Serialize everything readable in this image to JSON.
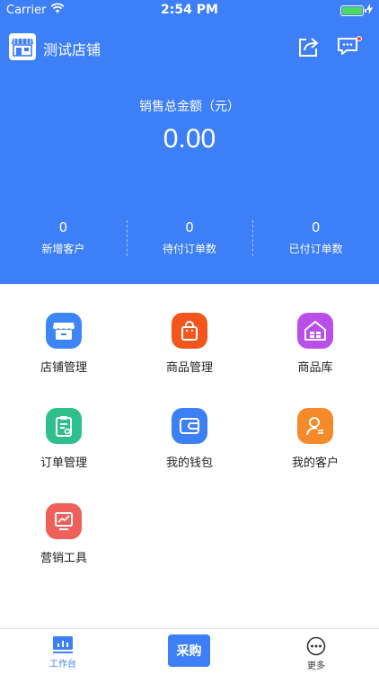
{
  "status_bar": {
    "carrier": "Carrier",
    "time": "2:54 PM"
  },
  "header": {
    "shop_name": "测试店铺"
  },
  "sales": {
    "label": "销售总金额（元）",
    "value": "0.00"
  },
  "stats": [
    {
      "value": "0",
      "label": "新增客户"
    },
    {
      "value": "0",
      "label": "待付订单数"
    },
    {
      "value": "0",
      "label": "已付订单数"
    }
  ],
  "menu": [
    {
      "label": "店铺管理",
      "icon": "store-icon",
      "color": "#3d86f7"
    },
    {
      "label": "商品管理",
      "icon": "shopping-bag-icon",
      "color": "#f2561d"
    },
    {
      "label": "商品库",
      "icon": "product-library-icon",
      "color": "#b94ee8"
    },
    {
      "label": "订单管理",
      "icon": "order-clipboard-icon",
      "color": "#2fbf8c"
    },
    {
      "label": "我的钱包",
      "icon": "wallet-icon",
      "color": "#3d7ff7"
    },
    {
      "label": "我的客户",
      "icon": "customer-icon",
      "color": "#f58a2a"
    },
    {
      "label": "营销工具",
      "icon": "marketing-chart-icon",
      "color": "#f0605a"
    }
  ],
  "tabbar": {
    "workbench": "工作台",
    "purchase": "采购",
    "more": "更多",
    "active_color": "#3d7ff7"
  }
}
